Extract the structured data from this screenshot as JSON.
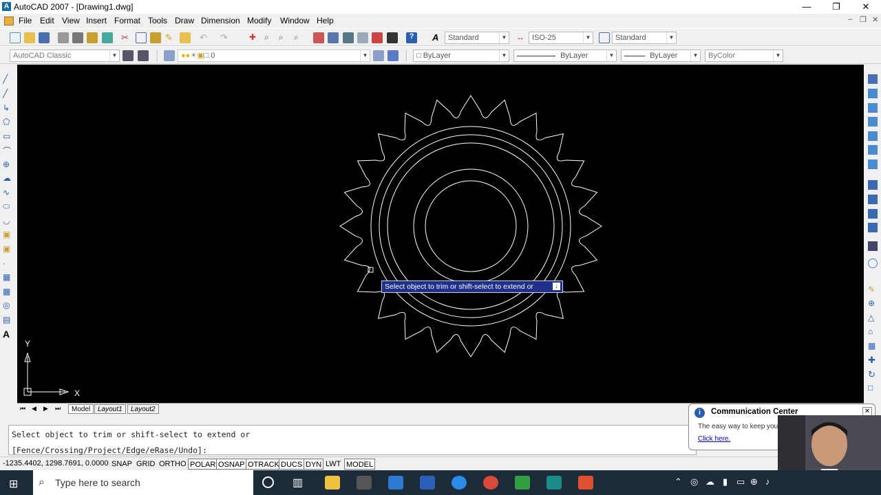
{
  "window": {
    "title": "AutoCAD 2007 - [Drawing1.dwg]"
  },
  "menu": [
    "File",
    "Edit",
    "View",
    "Insert",
    "Format",
    "Tools",
    "Draw",
    "Dimension",
    "Modify",
    "Window",
    "Help"
  ],
  "toolbar": {
    "text_style": "Standard",
    "dim_style": "ISO-25",
    "table_style": "Standard",
    "workspace": "AutoCAD Classic",
    "layer": "0",
    "color": "ByLayer",
    "linetype": "ByLayer",
    "lineweight": "ByLayer",
    "plotstyle": "ByColor"
  },
  "canvas": {
    "tooltip": "Select object to trim or shift-select to extend or",
    "ucs_x": "X",
    "ucs_y": "Y"
  },
  "tabs": [
    "Model",
    "Layout1",
    "Layout2"
  ],
  "command": {
    "line1": "Select object to trim or shift-select to extend or",
    "line2": "[Fence/Crossing/Project/Edge/eRase/Undo]:"
  },
  "status": {
    "coords": "-1235.4402, 1298.7691, 0.0000",
    "buttons": [
      "SNAP",
      "GRID",
      "ORTHO",
      "POLAR",
      "OSNAP",
      "OTRACK",
      "DUCS",
      "DYN",
      "LWT",
      "MODEL"
    ]
  },
  "communication_center": {
    "title": "Communication Center",
    "body": "The easy way to keep you",
    "link": "Click here."
  },
  "taskbar": {
    "search_placeholder": "Type here to search"
  },
  "colors": {
    "canvas": "#000000",
    "geometry": "#ffffff",
    "tooltip_bg": "#1f2f8a"
  }
}
